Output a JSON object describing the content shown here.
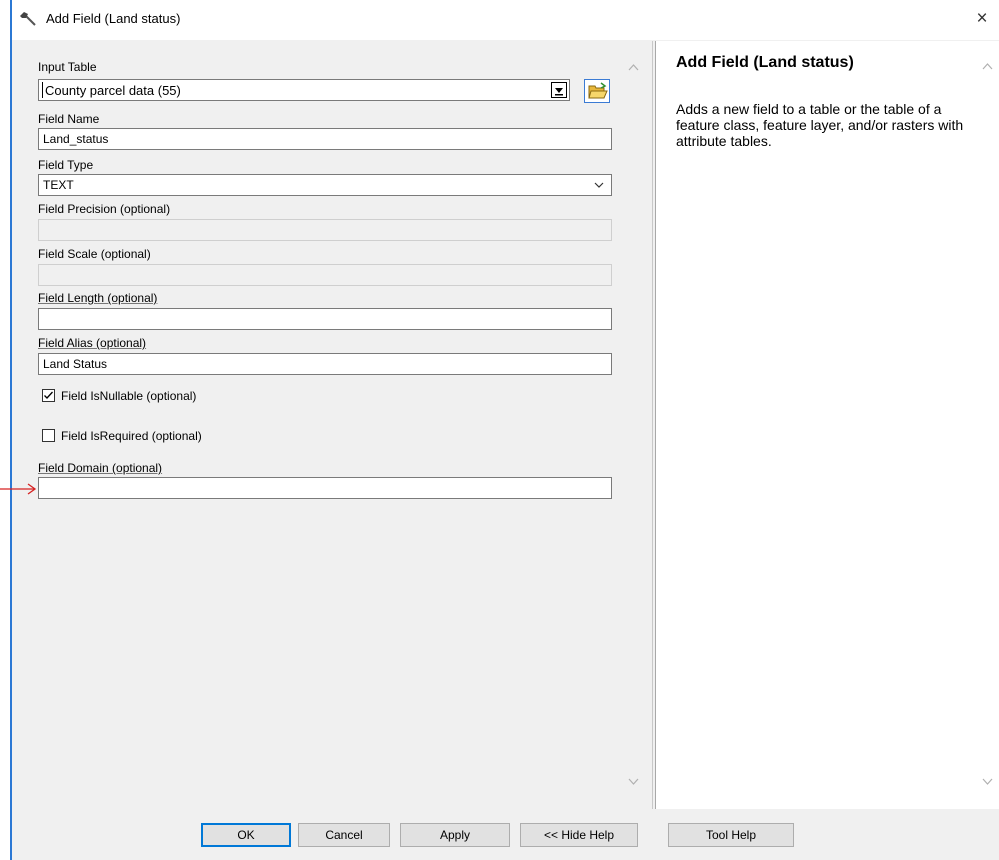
{
  "window": {
    "title": "Add Field (Land status)",
    "close_glyph": "×"
  },
  "form": {
    "input_table": {
      "label": "Input Table",
      "value": "County parcel data (55)"
    },
    "field_name": {
      "label": "Field Name",
      "value": "Land_status"
    },
    "field_type": {
      "label": "Field Type",
      "value": "TEXT"
    },
    "field_precision": {
      "label": "Field Precision (optional)",
      "value": ""
    },
    "field_scale": {
      "label": "Field Scale (optional)",
      "value": ""
    },
    "field_length": {
      "label": "Field Length (optional)",
      "value": ""
    },
    "field_alias": {
      "label": "Field Alias (optional)",
      "value": "Land Status"
    },
    "is_nullable": {
      "label": "Field IsNullable (optional)",
      "checked": true
    },
    "is_required": {
      "label": "Field IsRequired (optional)",
      "checked": false
    },
    "field_domain": {
      "label": "Field Domain (optional)",
      "value": ""
    }
  },
  "help": {
    "title": "Add Field (Land status)",
    "body": "Adds a new field to a table or the table of a feature class, feature layer, and/or rasters with attribute tables."
  },
  "buttons": {
    "ok": "OK",
    "cancel": "Cancel",
    "apply": "Apply",
    "hide_help": "<< Hide Help",
    "tool_help": "Tool Help"
  },
  "colors": {
    "accent": "#0078d7",
    "annotation_arrow": "#d62020",
    "dialog_bg": "#f0f0f0"
  },
  "icons": [
    "hammer-icon",
    "close-icon",
    "dropdown-arrow-icon",
    "open-folder-icon",
    "chevron-down-icon",
    "scroll-up-icon",
    "scroll-down-icon",
    "checkmark-icon",
    "red-arrow-icon"
  ]
}
